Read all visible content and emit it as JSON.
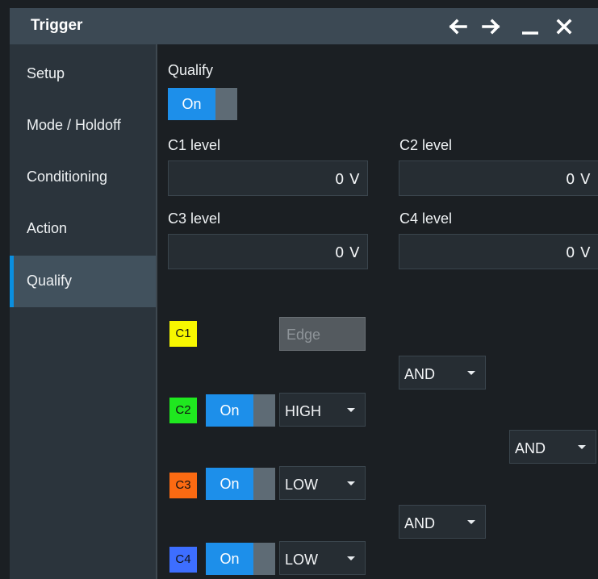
{
  "window": {
    "title": "Trigger"
  },
  "sidebar": {
    "items": [
      {
        "label": "Setup"
      },
      {
        "label": "Mode / Holdoff"
      },
      {
        "label": "Conditioning"
      },
      {
        "label": "Action"
      },
      {
        "label": "Qualify",
        "active": true
      }
    ]
  },
  "qualify": {
    "label": "Qualify",
    "toggle": "On"
  },
  "levels": {
    "c1": {
      "label": "C1 level",
      "value": "0 V"
    },
    "c2": {
      "label": "C2 level",
      "value": "0 V"
    },
    "c3": {
      "label": "C3 level",
      "value": "0 V"
    },
    "c4": {
      "label": "C4 level",
      "value": "0 V"
    }
  },
  "channels": {
    "c1": {
      "label": "C1",
      "color": "#f7f700",
      "type": "Edge"
    },
    "c2": {
      "label": "C2",
      "color": "#1fe81f",
      "toggle": "On",
      "state": "HIGH"
    },
    "c3": {
      "label": "C3",
      "color": "#fb6a12",
      "toggle": "On",
      "state": "LOW"
    },
    "c4": {
      "label": "C4",
      "color": "#3d6eff",
      "toggle": "On",
      "state": "LOW"
    }
  },
  "logic": {
    "op_c1_c2": "AND",
    "op_combined": "AND",
    "op_c3_c4": "AND"
  },
  "icons": [
    "arrow-left-icon",
    "arrow-right-icon",
    "minimize-icon",
    "close-icon"
  ]
}
